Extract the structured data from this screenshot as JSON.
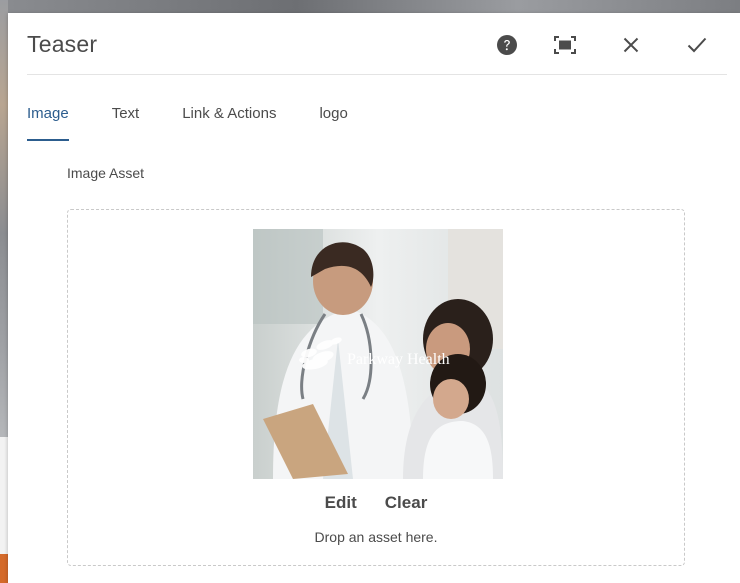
{
  "dialog": {
    "title": "Teaser",
    "header_actions": [
      {
        "name": "help",
        "icon": "help-circle-icon"
      },
      {
        "name": "fullscreen",
        "icon": "fullscreen-icon"
      },
      {
        "name": "cancel",
        "icon": "close-icon"
      },
      {
        "name": "done",
        "icon": "checkmark-icon"
      }
    ]
  },
  "tabs": [
    {
      "label": "Image",
      "active": true
    },
    {
      "label": "Text",
      "active": false
    },
    {
      "label": "Link & Actions",
      "active": false
    },
    {
      "label": "logo",
      "active": false
    }
  ],
  "image_asset": {
    "label": "Image Asset",
    "thumbnail_watermark": "Parkway Health",
    "edit_label": "Edit",
    "clear_label": "Clear",
    "drop_hint": "Drop an asset here."
  },
  "colors": {
    "accent": "#2c5d8e",
    "text": "#4b4b4b",
    "border": "#c9c9c9"
  }
}
